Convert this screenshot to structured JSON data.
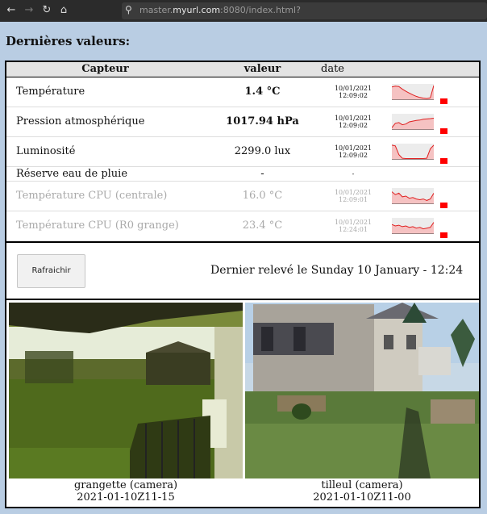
{
  "browser": {
    "url_prefix": "master.",
    "url_host": "myurl.com",
    "url_rest": ":8080/index.html?",
    "icons": [
      "back-arrow-icon",
      "forward-arrow-icon",
      "reload-icon",
      "home-icon",
      "search-icon"
    ]
  },
  "page": {
    "title": "Dernières valeurs:",
    "background": "#b9cde3"
  },
  "table": {
    "headers": {
      "sensor": "Capteur",
      "value": "valeur",
      "date": "date"
    },
    "rows": [
      {
        "name": "Température",
        "value": "1.4 °C",
        "bold": true,
        "date1": "10/01/2021",
        "date2": "12:09:02",
        "dim": false,
        "trend": [
          0.85,
          0.9,
          0.88,
          0.7,
          0.55,
          0.42,
          0.3,
          0.2,
          0.12,
          0.08,
          0.05,
          0.1,
          0.95
        ]
      },
      {
        "name": "Pression atmosphérique",
        "value": "1017.94 hPa",
        "bold": true,
        "date1": "10/01/2021",
        "date2": "12:09:02",
        "dim": false,
        "trend": [
          0.1,
          0.4,
          0.45,
          0.3,
          0.35,
          0.5,
          0.55,
          0.6,
          0.62,
          0.68,
          0.7,
          0.72,
          0.75
        ]
      },
      {
        "name": "Luminosité",
        "value": "2299.0 lux",
        "bold": false,
        "date1": "10/01/2021",
        "date2": "12:09:02",
        "dim": false,
        "trend": [
          0.95,
          0.9,
          0.3,
          0.05,
          0.03,
          0.03,
          0.03,
          0.03,
          0.03,
          0.03,
          0.05,
          0.7,
          0.95
        ]
      },
      {
        "name": "Réserve eau de pluie",
        "value": "-",
        "bold": false,
        "date1": "-",
        "date2": "",
        "dim": false,
        "short": true,
        "trend": []
      },
      {
        "name": "Température CPU (centrale)",
        "value": "16.0 °C",
        "bold": false,
        "date1": "10/01/2021",
        "date2": "12:09:01",
        "dim": true,
        "trend": [
          0.8,
          0.6,
          0.7,
          0.45,
          0.5,
          0.35,
          0.4,
          0.3,
          0.25,
          0.3,
          0.2,
          0.3,
          0.7
        ]
      },
      {
        "name": "Température CPU (R0 grange)",
        "value": "23.4 °C",
        "bold": false,
        "date1": "10/01/2021",
        "date2": "12:24:01",
        "dim": true,
        "trend": [
          0.6,
          0.5,
          0.55,
          0.45,
          0.5,
          0.4,
          0.45,
          0.35,
          0.4,
          0.3,
          0.35,
          0.4,
          0.75
        ]
      }
    ],
    "spark_fill": "#f5c2c2",
    "spark_line": "#e02020",
    "status_color": "#ff0000"
  },
  "controls": {
    "refresh_label": "Rafraichir",
    "last_reading": "Dernier relevé le Sunday 10 January - 12:24"
  },
  "cameras": [
    {
      "name": "grangette (camera)",
      "timestamp": "2021-01-10Z11-15"
    },
    {
      "name": "tilleul (camera)",
      "timestamp": "2021-01-10Z11-00"
    }
  ]
}
